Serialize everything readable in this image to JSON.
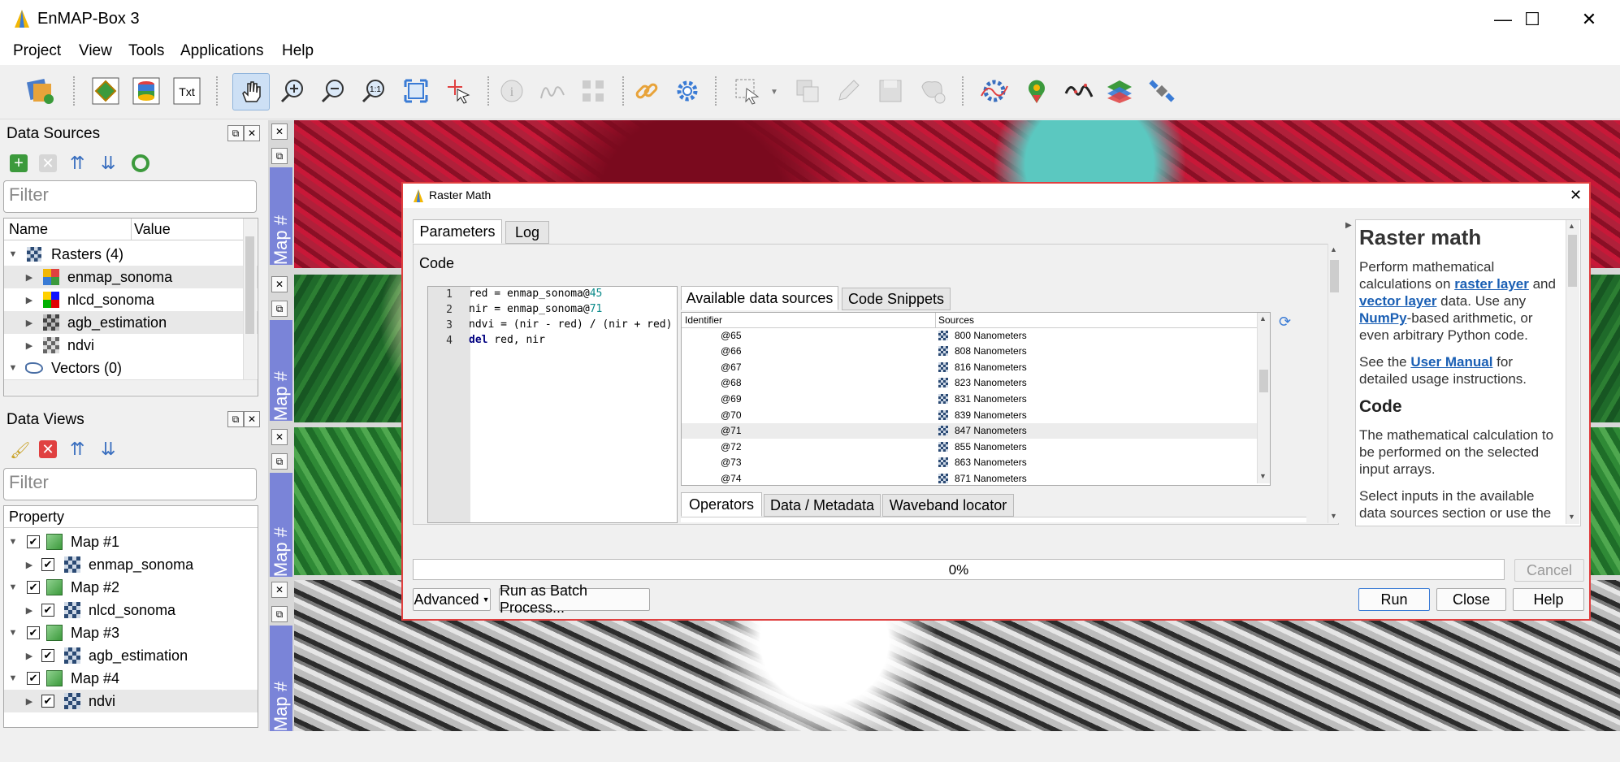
{
  "window": {
    "title": "EnMAP-Box 3",
    "min": "—",
    "max": "☐",
    "close": "✕"
  },
  "menu": [
    "Project",
    "View",
    "Tools",
    "Applications",
    "Help"
  ],
  "data_sources": {
    "title": "Data Sources",
    "filter_placeholder": "Filter",
    "columns": [
      "Name",
      "Value"
    ],
    "rasters_label": "Rasters (4)",
    "rasters": [
      "enmap_sonoma",
      "nlcd_sonoma",
      "agb_estimation",
      "ndvi"
    ],
    "vectors_label": "Vectors (0)"
  },
  "data_views": {
    "title": "Data Views",
    "filter_placeholder": "Filter",
    "column": "Property",
    "maps": [
      {
        "name": "Map #1",
        "layer": "enmap_sonoma"
      },
      {
        "name": "Map #2",
        "layer": "nlcd_sonoma"
      },
      {
        "name": "Map #3",
        "layer": "agb_estimation"
      },
      {
        "name": "Map #4",
        "layer": "ndvi"
      }
    ]
  },
  "map_tab_label": "Map #",
  "dialog": {
    "title": "Raster Math",
    "tabs": [
      "Parameters",
      "Log"
    ],
    "code_label": "Code",
    "code_lines": [
      {
        "n": "1",
        "pre": "red = enmap_sonoma@",
        "num": "45",
        "post": ""
      },
      {
        "n": "2",
        "pre": "nir = enmap_sonoma@",
        "num": "71",
        "post": ""
      },
      {
        "n": "3",
        "pre": "ndvi = (nir - red) / (nir + red)",
        "num": "",
        "post": ""
      },
      {
        "n": "4",
        "kw": "del",
        "pre": " red, nir",
        "num": "",
        "post": ""
      }
    ],
    "ds_tabs": [
      "Available data sources",
      "Code Snippets"
    ],
    "ds_columns": [
      "Identifier",
      "Sources"
    ],
    "ds_rows": [
      {
        "id": "@65",
        "src": "800 Nanometers"
      },
      {
        "id": "@66",
        "src": "808 Nanometers"
      },
      {
        "id": "@67",
        "src": "816 Nanometers"
      },
      {
        "id": "@68",
        "src": "823 Nanometers"
      },
      {
        "id": "@69",
        "src": "831 Nanometers"
      },
      {
        "id": "@70",
        "src": "839 Nanometers"
      },
      {
        "id": "@71",
        "src": "847 Nanometers"
      },
      {
        "id": "@72",
        "src": "855 Nanometers"
      },
      {
        "id": "@73",
        "src": "863 Nanometers"
      },
      {
        "id": "@74",
        "src": "871 Nanometers"
      }
    ],
    "bottom_tabs": [
      "Operators",
      "Data / Metadata",
      "Waveband locator"
    ],
    "progress": "0%",
    "progress_value": 0,
    "cancel": "Cancel",
    "advanced": "Advanced",
    "batch": "Run as Batch Process...",
    "run": "Run",
    "close": "Close",
    "help_btn": "Help"
  },
  "help": {
    "title": "Raster math",
    "p1_a": "Perform mathematical calculations on ",
    "link_raster": "raster layer",
    "p1_b": " and ",
    "link_vector": "vector layer",
    "p1_c": " data. Use any ",
    "link_numpy": "NumPy",
    "p1_d": "-based arithmetic, or even arbitrary Python code.",
    "p2_a": "See the ",
    "link_manual": "User Manual",
    "p2_b": " for detailed usage instructions.",
    "h_code": "Code",
    "p3": "The mathematical calculation to be performed on the selected input arrays.",
    "p4": "Select inputs in the available data sources section or use the"
  }
}
